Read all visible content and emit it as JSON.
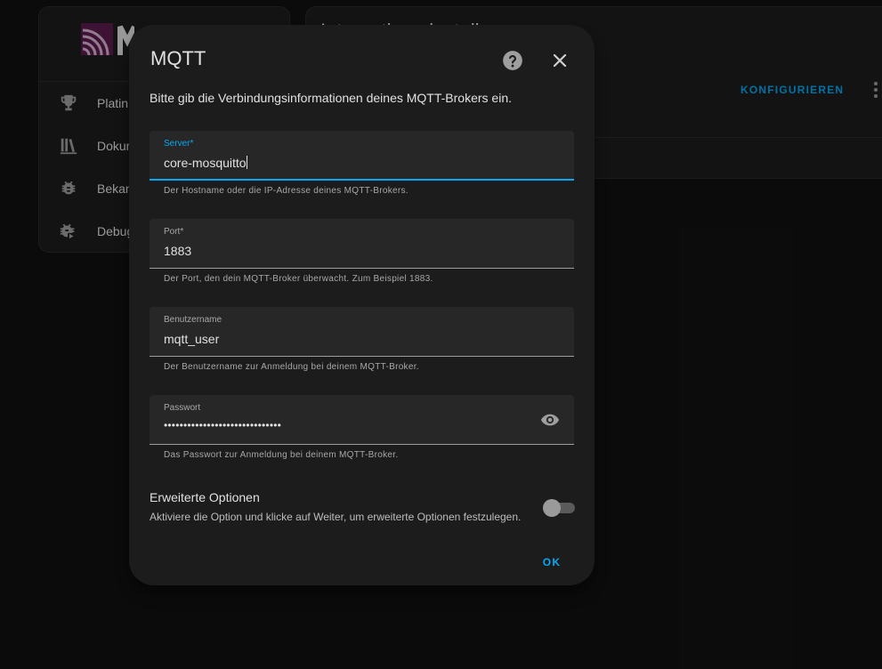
{
  "background": {
    "sidebar_items": [
      {
        "icon": "trophy-icon",
        "label": "Platin"
      },
      {
        "icon": "books-icon",
        "label": "Dokum"
      },
      {
        "icon": "bug-icon",
        "label": "Bekan"
      },
      {
        "icon": "bug-play-icon",
        "label": "Debug"
      }
    ],
    "card_title": "Integration einstellen",
    "configure_label": "KONFIGURIEREN",
    "menu_icon": "dots-vertical-icon"
  },
  "dialog": {
    "title": "MQTT",
    "help_icon": "help-circle-icon",
    "close_icon": "close-icon",
    "description": "Bitte gib die Verbindungsinformationen deines MQTT-Brokers ein.",
    "fields": {
      "server": {
        "label": "Server*",
        "value": "core-mosquitto",
        "helper": "Der Hostname oder die IP-Adresse deines MQTT-Brokers."
      },
      "port": {
        "label": "Port*",
        "value": "1883",
        "helper": "Der Port, den dein MQTT-Broker überwacht. Zum Beispiel 1883."
      },
      "username": {
        "label": "Benutzername",
        "value": "mqtt_user",
        "helper": "Der Benutzername zur Anmeldung bei deinem MQTT-Broker."
      },
      "password": {
        "label": "Passwort",
        "value": "••••••••••••••••••••••••••••••",
        "helper": "Das Passwort zur Anmeldung bei deinem MQTT-Broker.",
        "toggle_icon": "eye-icon"
      }
    },
    "advanced": {
      "title": "Erweiterte Optionen",
      "description_before": "Aktiviere die Option und klicke auf ",
      "description_emph": "Weiter",
      "description_after": ", um erweiterte Optionen festzulegen.",
      "enabled": false
    },
    "ok_label": "OK"
  },
  "colors": {
    "accent": "#03a9f4",
    "dialog_bg": "#1c1c1c",
    "field_bg": "#272727"
  }
}
